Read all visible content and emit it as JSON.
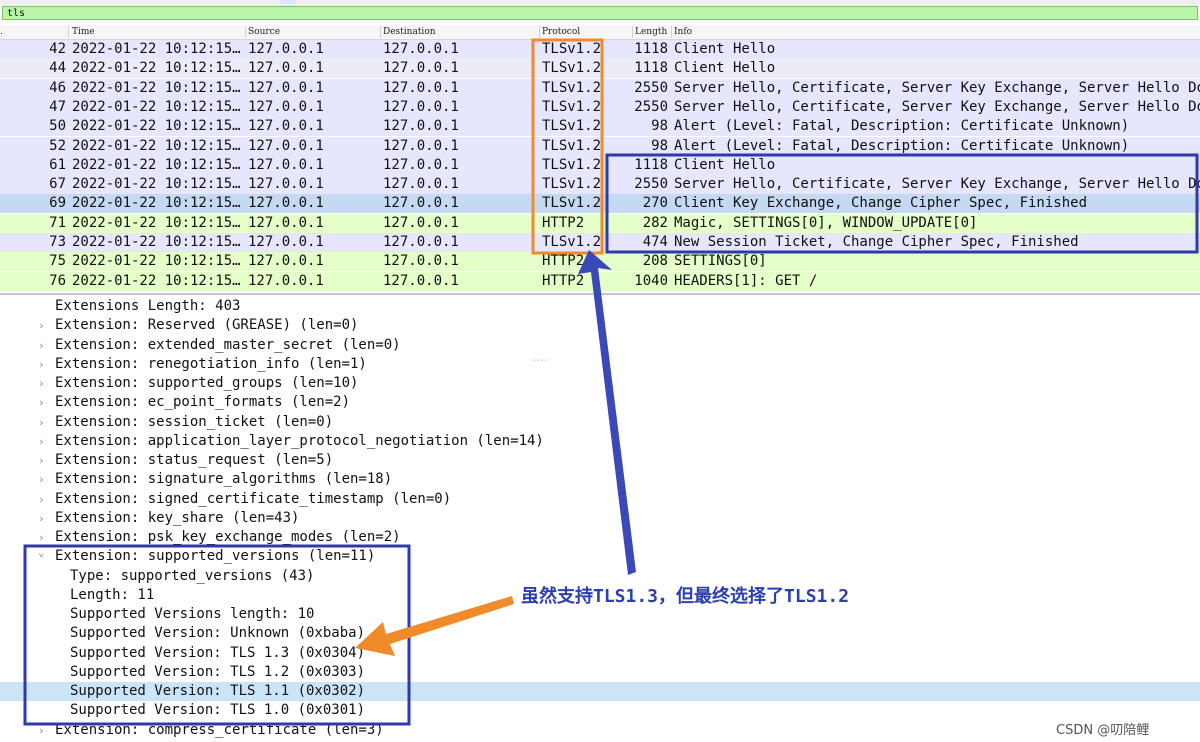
{
  "filter": {
    "value": "tls"
  },
  "columns": [
    "Time",
    "Source",
    "Destination",
    "Protocol",
    "Length",
    "Info"
  ],
  "colors": {
    "tls_row": "#e7e6ff",
    "tls_row_alt": "#ecebf8",
    "http2_row": "#e4ffc7",
    "selected_row": "#c5d9f2",
    "orange_box": "#f08a2b",
    "blue_box": "#2f3aa8"
  },
  "packets": [
    {
      "no": "42",
      "time": "2022-01-22 10:12:15…",
      "src": "127.0.0.1",
      "dst": "127.0.0.1",
      "proto": "TLSv1.2",
      "len": "1118",
      "info": "Client Hello",
      "kind": "tls"
    },
    {
      "no": "44",
      "time": "2022-01-22 10:12:15…",
      "src": "127.0.0.1",
      "dst": "127.0.0.1",
      "proto": "TLSv1.2",
      "len": "1118",
      "info": "Client Hello",
      "kind": "tls_alt"
    },
    {
      "no": "46",
      "time": "2022-01-22 10:12:15…",
      "src": "127.0.0.1",
      "dst": "127.0.0.1",
      "proto": "TLSv1.2",
      "len": "2550",
      "info": "Server Hello, Certificate, Server Key Exchange, Server Hello Done",
      "kind": "tls"
    },
    {
      "no": "47",
      "time": "2022-01-22 10:12:15…",
      "src": "127.0.0.1",
      "dst": "127.0.0.1",
      "proto": "TLSv1.2",
      "len": "2550",
      "info": "Server Hello, Certificate, Server Key Exchange, Server Hello Done",
      "kind": "tls"
    },
    {
      "no": "50",
      "time": "2022-01-22 10:12:15…",
      "src": "127.0.0.1",
      "dst": "127.0.0.1",
      "proto": "TLSv1.2",
      "len": "98",
      "info": "Alert (Level: Fatal, Description: Certificate Unknown)",
      "kind": "tls"
    },
    {
      "no": "52",
      "time": "2022-01-22 10:12:15…",
      "src": "127.0.0.1",
      "dst": "127.0.0.1",
      "proto": "TLSv1.2",
      "len": "98",
      "info": "Alert (Level: Fatal, Description: Certificate Unknown)",
      "kind": "tls"
    },
    {
      "no": "61",
      "time": "2022-01-22 10:12:15…",
      "src": "127.0.0.1",
      "dst": "127.0.0.1",
      "proto": "TLSv1.2",
      "len": "1118",
      "info": "Client Hello",
      "kind": "tls"
    },
    {
      "no": "67",
      "time": "2022-01-22 10:12:15…",
      "src": "127.0.0.1",
      "dst": "127.0.0.1",
      "proto": "TLSv1.2",
      "len": "2550",
      "info": "Server Hello, Certificate, Server Key Exchange, Server Hello Done",
      "kind": "tls"
    },
    {
      "no": "69",
      "time": "2022-01-22 10:12:15…",
      "src": "127.0.0.1",
      "dst": "127.0.0.1",
      "proto": "TLSv1.2",
      "len": "270",
      "info": "Client Key Exchange, Change Cipher Spec, Finished",
      "kind": "selected"
    },
    {
      "no": "71",
      "time": "2022-01-22 10:12:15…",
      "src": "127.0.0.1",
      "dst": "127.0.0.1",
      "proto": "HTTP2",
      "len": "282",
      "info": "Magic, SETTINGS[0], WINDOW_UPDATE[0]",
      "kind": "http2"
    },
    {
      "no": "73",
      "time": "2022-01-22 10:12:15…",
      "src": "127.0.0.1",
      "dst": "127.0.0.1",
      "proto": "TLSv1.2",
      "len": "474",
      "info": "New Session Ticket, Change Cipher Spec, Finished",
      "kind": "tls"
    },
    {
      "no": "75",
      "time": "2022-01-22 10:12:15…",
      "src": "127.0.0.1",
      "dst": "127.0.0.1",
      "proto": "HTTP2",
      "len": "208",
      "info": "SETTINGS[0]",
      "kind": "http2"
    },
    {
      "no": "76",
      "time": "2022-01-22 10:12:15…",
      "src": "127.0.0.1",
      "dst": "127.0.0.1",
      "proto": "HTTP2",
      "len": "1040",
      "info": "HEADERS[1]: GET /",
      "kind": "http2"
    }
  ],
  "details": [
    {
      "text": "Extensions Length: 403",
      "level": 0,
      "arrow": ""
    },
    {
      "text": "Extension: Reserved (GREASE) (len=0)",
      "level": 0,
      "arrow": ">"
    },
    {
      "text": "Extension: extended_master_secret (len=0)",
      "level": 0,
      "arrow": ">"
    },
    {
      "text": "Extension: renegotiation_info (len=1)",
      "level": 0,
      "arrow": ">"
    },
    {
      "text": "Extension: supported_groups (len=10)",
      "level": 0,
      "arrow": ">"
    },
    {
      "text": "Extension: ec_point_formats (len=2)",
      "level": 0,
      "arrow": ">"
    },
    {
      "text": "Extension: session_ticket (len=0)",
      "level": 0,
      "arrow": ">"
    },
    {
      "text": "Extension: application_layer_protocol_negotiation (len=14)",
      "level": 0,
      "arrow": ">"
    },
    {
      "text": "Extension: status_request (len=5)",
      "level": 0,
      "arrow": ">"
    },
    {
      "text": "Extension: signature_algorithms (len=18)",
      "level": 0,
      "arrow": ">"
    },
    {
      "text": "Extension: signed_certificate_timestamp (len=0)",
      "level": 0,
      "arrow": ">"
    },
    {
      "text": "Extension: key_share (len=43)",
      "level": 0,
      "arrow": ">"
    },
    {
      "text": "Extension: psk_key_exchange_modes (len=2)",
      "level": 0,
      "arrow": ">"
    },
    {
      "text": "Extension: supported_versions (len=11)",
      "level": 0,
      "arrow": "v"
    },
    {
      "text": "Type: supported_versions (43)",
      "level": 1,
      "arrow": ""
    },
    {
      "text": "Length: 11",
      "level": 1,
      "arrow": ""
    },
    {
      "text": "Supported Versions length: 10",
      "level": 1,
      "arrow": ""
    },
    {
      "text": "Supported Version: Unknown (0xbaba)",
      "level": 1,
      "arrow": ""
    },
    {
      "text": "Supported Version: TLS 1.3 (0x0304)",
      "level": 1,
      "arrow": ""
    },
    {
      "text": "Supported Version: TLS 1.2 (0x0303)",
      "level": 1,
      "arrow": ""
    },
    {
      "text": "Supported Version: TLS 1.1 (0x0302)",
      "level": 1,
      "arrow": "",
      "selected": true
    },
    {
      "text": "Supported Version: TLS 1.0 (0x0301)",
      "level": 1,
      "arrow": ""
    },
    {
      "text": "Extension: compress_certificate (len=3)",
      "level": 0,
      "arrow": ">"
    }
  ],
  "annotation": "虽然支持TLS1.3，但最终选择了TLS1.2",
  "footer": "CSDN @叨陪鲤"
}
